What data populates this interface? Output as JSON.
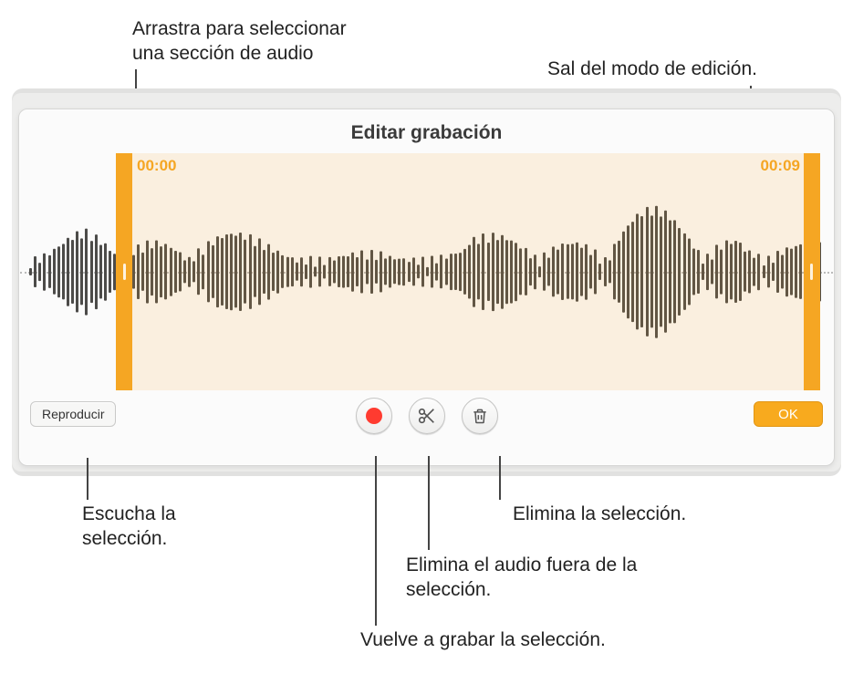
{
  "callouts": {
    "drag_select": "Arrastra para seleccionar una sección de audio",
    "exit_edit": "Sal del modo de edición.",
    "play_selection": "Escucha la selección.",
    "delete_selection": "Elimina la selección.",
    "trim_outside": "Elimina el audio fuera de la selección.",
    "rerecord_selection": "Vuelve a grabar la selección."
  },
  "editor": {
    "title": "Editar grabación",
    "time_start": "00:00",
    "time_end": "00:09",
    "play_label": "Reproducir",
    "ok_label": "OK"
  },
  "icons": {
    "record": "record-icon",
    "scissors": "scissors-icon",
    "trash": "trash-icon"
  }
}
